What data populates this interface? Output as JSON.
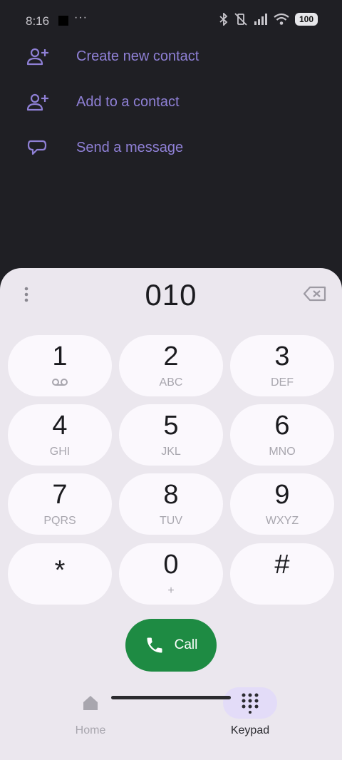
{
  "status_bar": {
    "time": "8:16",
    "dots": "···",
    "battery": "100"
  },
  "actions": [
    {
      "label": "Create new contact",
      "icon": "person-add-icon"
    },
    {
      "label": "Add to a contact",
      "icon": "person-add-icon"
    },
    {
      "label": "Send a message",
      "icon": "message-icon"
    }
  ],
  "dialer": {
    "number": "010",
    "keys": [
      {
        "digit": "1",
        "letters": ""
      },
      {
        "digit": "2",
        "letters": "ABC"
      },
      {
        "digit": "3",
        "letters": "DEF"
      },
      {
        "digit": "4",
        "letters": "GHI"
      },
      {
        "digit": "5",
        "letters": "JKL"
      },
      {
        "digit": "6",
        "letters": "MNO"
      },
      {
        "digit": "7",
        "letters": "PQRS"
      },
      {
        "digit": "8",
        "letters": "TUV"
      },
      {
        "digit": "9",
        "letters": "WXYZ"
      },
      {
        "digit": "*",
        "letters": ""
      },
      {
        "digit": "0",
        "letters": "+"
      },
      {
        "digit": "#",
        "letters": ""
      }
    ],
    "call_label": "Call"
  },
  "nav": {
    "home_label": "Home",
    "keypad_label": "Keypad"
  },
  "colors": {
    "accent": "#8f80d6",
    "call": "#1e8b43",
    "sheet": "#ebe7ee",
    "key": "#fbf8fd"
  }
}
